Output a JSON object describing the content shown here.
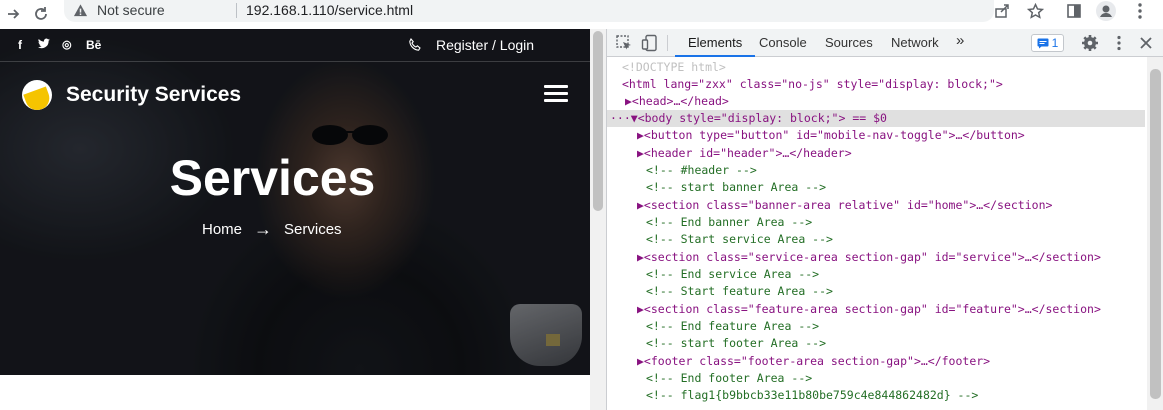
{
  "browser": {
    "security_label": "Not secure",
    "url": "192.168.1.110/service.html"
  },
  "site": {
    "social": [
      "f",
      "t",
      "◎",
      "Bē"
    ],
    "register_login": "Register / Login",
    "brand": "Security Services",
    "hero_title": "Services",
    "breadcrumb": {
      "home": "Home",
      "arrow": "→",
      "current": "Services"
    }
  },
  "devtools": {
    "tabs": [
      "Elements",
      "Console",
      "Sources",
      "Network"
    ],
    "more_tabs": "»",
    "issues_count": "1",
    "lines": [
      {
        "text": "<!DOCTYPE html>"
      },
      {
        "text": "<html lang=\"zxx\" class=\"no-js\" style=\"display: block;\">"
      },
      {
        "text": "▶<head>…</head>"
      },
      {
        "text": "···▼<body style=\"display: block;\"> == $0"
      },
      {
        "text": "▶<button type=\"button\" id=\"mobile-nav-toggle\">…</button>"
      },
      {
        "text": "▶<header id=\"header\">…</header>"
      },
      {
        "text": "<!-- #header -->"
      },
      {
        "text": "<!-- start banner Area -->"
      },
      {
        "text": "▶<section class=\"banner-area relative\" id=\"home\">…</section>"
      },
      {
        "text": "<!-- End banner Area -->"
      },
      {
        "text": "<!-- Start service Area -->"
      },
      {
        "text": "▶<section class=\"service-area section-gap\" id=\"service\">…</section>"
      },
      {
        "text": "<!-- End service Area -->"
      },
      {
        "text": "<!-- Start feature Area -->"
      },
      {
        "text": "▶<section class=\"feature-area section-gap\" id=\"feature\">…</section>"
      },
      {
        "text": "<!-- End feature Area -->"
      },
      {
        "text": "<!-- start footer Area -->"
      },
      {
        "text": "▶<footer class=\"footer-area section-gap\">…</footer>"
      },
      {
        "text": "<!-- End footer Area -->"
      },
      {
        "text": "<!-- flag1{b9bbcb33e11b80be759c4e844862482d} -->"
      }
    ]
  }
}
